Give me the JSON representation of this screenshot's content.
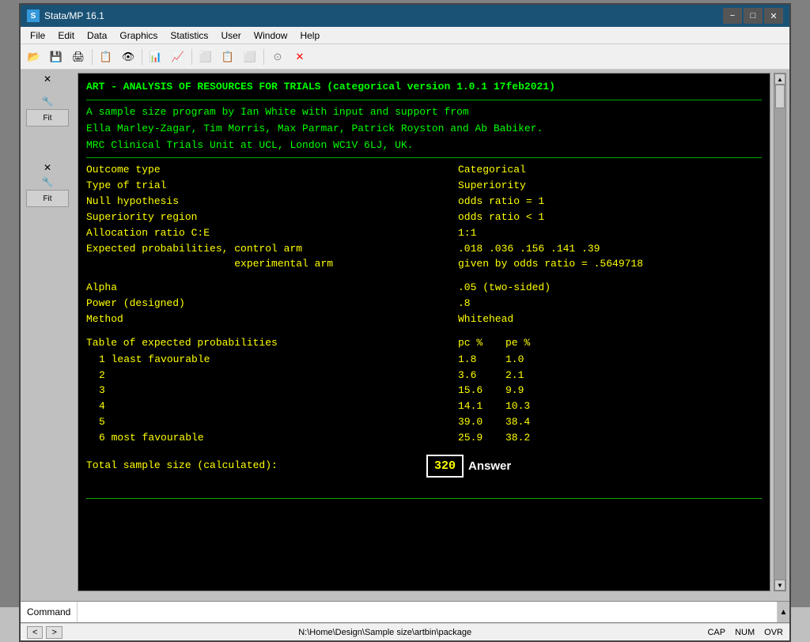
{
  "titlebar": {
    "title": "Stata/MP 16.1",
    "minimize_label": "−",
    "maximize_label": "□",
    "close_label": "✕"
  },
  "menubar": {
    "items": [
      "File",
      "Edit",
      "Data",
      "Graphics",
      "Statistics",
      "User",
      "Window",
      "Help"
    ]
  },
  "toolbar": {
    "buttons": [
      "📂",
      "💾",
      "🖨",
      "📋",
      "👁",
      "📊",
      "📈",
      "⬜",
      "📋",
      "⬜",
      "⬜",
      "⊙",
      "✕"
    ]
  },
  "results": {
    "title_line": "ART - ANALYSIS OF RESOURCES FOR TRIALS (categorical version 1.0.1 17feb2021)",
    "author_line1": "A sample size program by Ian White with input and support from",
    "author_line2": "Ella Marley-Zagar, Tim Morris, Max Parmar, Patrick Royston and Ab Babiker.",
    "author_line3": "MRC Clinical Trials Unit at UCL, London WC1V 6LJ, UK.",
    "fields": [
      {
        "label": "Outcome type",
        "value": "Categorical"
      },
      {
        "label": "Type of trial",
        "value": "Superiority"
      },
      {
        "label": "Null hypothesis",
        "value": "odds ratio = 1"
      },
      {
        "label": "Superiority region",
        "value": "odds ratio < 1"
      },
      {
        "label": "Allocation ratio C:E",
        "value": "1:1"
      },
      {
        "label": "Expected probabilities, control arm",
        "value": ".018 .036 .156 .141 .39"
      },
      {
        "label": "                        experimental arm",
        "value": "given by odds ratio = .5649718"
      }
    ],
    "fields2": [
      {
        "label": "Alpha",
        "value": ".05 (two-sided)"
      },
      {
        "label": "Power (designed)",
        "value": ".8"
      },
      {
        "label": "Method",
        "value": "Whitehead"
      }
    ],
    "table_header": "Table of expected probabilities",
    "table_col1": "pc %",
    "table_col2": "pe %",
    "table_rows": [
      {
        "rank": "1 least favourable",
        "pc": "1.8",
        "pe": "1.0"
      },
      {
        "rank": "2",
        "pc": "3.6",
        "pe": "2.1"
      },
      {
        "rank": "3",
        "pc": "15.6",
        "pe": "9.9"
      },
      {
        "rank": "4",
        "pc": "14.1",
        "pe": "10.3"
      },
      {
        "rank": "5",
        "pc": "39.0",
        "pe": "38.4"
      },
      {
        "rank": "6 most favourable",
        "pc": "25.9",
        "pe": "38.2"
      }
    ],
    "sample_size_label": "Total sample size (calculated):",
    "sample_size_value": "320",
    "answer_label": "Answer"
  },
  "command": {
    "label": "Command",
    "placeholder": ""
  },
  "statusbar": {
    "path": "N:\\Home\\Design\\Sample size\\artbin\\package",
    "cap": "CAP",
    "num": "NUM",
    "ovr": "OVR"
  },
  "nav": {
    "left_btn": "<",
    "right_btn": ">"
  }
}
